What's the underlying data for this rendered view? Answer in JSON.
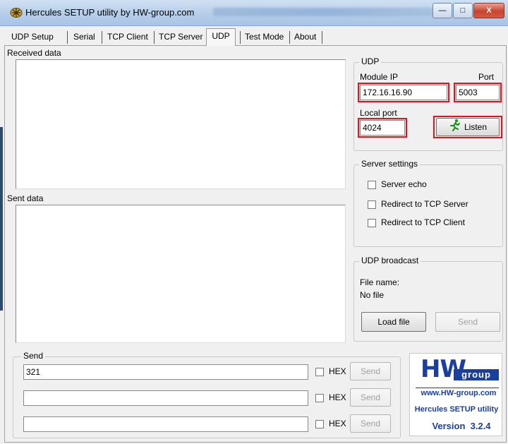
{
  "window": {
    "title": "Hercules SETUP utility by HW-group.com",
    "controls": {
      "minimize": "—",
      "maximize": "□",
      "close": "X"
    }
  },
  "tabs": [
    {
      "label": "UDP Setup"
    },
    {
      "label": "Serial"
    },
    {
      "label": "TCP Client"
    },
    {
      "label": "TCP Server"
    },
    {
      "label": "UDP",
      "active": true
    },
    {
      "label": "Test Mode"
    },
    {
      "label": "About"
    }
  ],
  "received": {
    "label": "Received data"
  },
  "sent": {
    "label": "Sent data"
  },
  "udp": {
    "group_title": "UDP",
    "module_ip_label": "Module IP",
    "module_ip_value": "172.16.16.90",
    "port_label": "Port",
    "port_value": "5003",
    "local_port_label": "Local port",
    "local_port_value": "4024",
    "listen_label": "Listen"
  },
  "server_settings": {
    "group_title": "Server settings",
    "options": [
      "Server echo",
      "Redirect to TCP Server",
      "Redirect to TCP Client"
    ]
  },
  "udp_broadcast": {
    "group_title": "UDP broadcast",
    "file_name_label": "File name:",
    "file_name_value": "No file",
    "load_file_label": "Load file",
    "send_label": "Send"
  },
  "send": {
    "group_title": "Send",
    "rows": [
      {
        "value": "321",
        "hex_label": "HEX",
        "send_label": "Send"
      },
      {
        "value": "",
        "hex_label": "HEX",
        "send_label": "Send"
      },
      {
        "value": "",
        "hex_label": "HEX",
        "send_label": "Send"
      }
    ]
  },
  "logo": {
    "brand": "HW",
    "group": "group",
    "url": "www.HW-group.com",
    "product": "Hercules SETUP utility",
    "version": "Version  3.2.4"
  },
  "colors": {
    "highlight_red": "#e0141e",
    "logo_blue": "#1a3f9e"
  }
}
